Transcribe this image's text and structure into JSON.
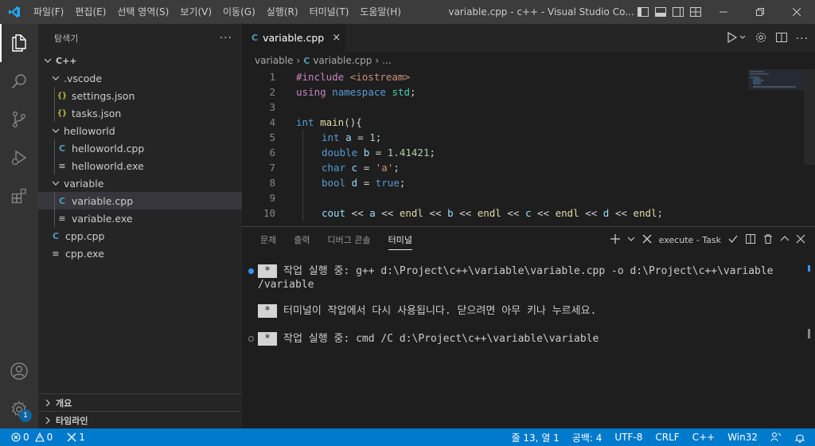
{
  "titlebar": {
    "menus": [
      "파일(F)",
      "편집(E)",
      "선택 영역(S)",
      "보기(V)",
      "이동(G)",
      "실행(R)",
      "터미널(T)",
      "도움말(H)"
    ],
    "window_title": "variable.cpp - c++ - Visual Studio Co..."
  },
  "sidebar": {
    "title": "탐색기",
    "more": "···",
    "root": "C++",
    "tree": [
      {
        "label": ".vscode",
        "kind": "folder",
        "depth": 1
      },
      {
        "label": "settings.json",
        "kind": "json",
        "depth": 2
      },
      {
        "label": "tasks.json",
        "kind": "json",
        "depth": 2
      },
      {
        "label": "helloworld",
        "kind": "folder",
        "depth": 1
      },
      {
        "label": "helloworld.cpp",
        "kind": "cpp",
        "depth": 2
      },
      {
        "label": "helloworld.exe",
        "kind": "exe",
        "depth": 2
      },
      {
        "label": "variable",
        "kind": "folder",
        "depth": 1
      },
      {
        "label": "variable.cpp",
        "kind": "cpp",
        "depth": 2,
        "selected": true
      },
      {
        "label": "variable.exe",
        "kind": "exe",
        "depth": 2
      },
      {
        "label": "cpp.cpp",
        "kind": "cpp",
        "depth": 1
      },
      {
        "label": "cpp.exe",
        "kind": "exe",
        "depth": 1
      }
    ],
    "outline": "개요",
    "timeline": "타임라인"
  },
  "editor": {
    "tab_label": "variable.cpp",
    "tab_close": "×",
    "breadcrumb": {
      "folder": "variable",
      "file": "variable.cpp",
      "ellipsis": "..."
    },
    "line_numbers": [
      "1",
      "2",
      "3",
      "4",
      "5",
      "6",
      "7",
      "8",
      "9",
      "10"
    ]
  },
  "code": {
    "l1": {
      "a": "#include ",
      "b": "<iostream>"
    },
    "l2": {
      "a": "using",
      "b": " ",
      "c": "namespace",
      "d": " ",
      "e": "std",
      "f": ";"
    },
    "l4": {
      "a": "int",
      "b": " ",
      "c": "main",
      "d": "(){"
    },
    "l5": {
      "a": "int",
      "b": " ",
      "c": "a",
      "d": " = ",
      "e": "1",
      "f": ";"
    },
    "l6": {
      "a": "double",
      "b": " ",
      "c": "b",
      "d": " = ",
      "e": "1.41421",
      "f": ";"
    },
    "l7": {
      "a": "char",
      "b": " ",
      "c": "c",
      "d": " = ",
      "e": "'a'",
      "f": ";"
    },
    "l8": {
      "a": "bool",
      "b": " ",
      "c": "d",
      "d": " = ",
      "e": "true",
      "f": ";"
    },
    "l10": {
      "a": "cout",
      "b": " << ",
      "c": "a",
      "d": " << ",
      "e": "endl",
      "f": " << ",
      "g": "b",
      "h": " << ",
      "i": "endl",
      "j": " << ",
      "k": "c",
      "l": " << ",
      "m": "endl",
      "n": " << ",
      "o": "d",
      "p": " << ",
      "q": "endl",
      "r": ";"
    }
  },
  "panel": {
    "tabs": [
      "문제",
      "출력",
      "디버그 콘솔",
      "터미널"
    ],
    "active_tab": "터미널",
    "task_label": "execute - Task",
    "terminal": {
      "star": "*",
      "line1": "작업 실행 중: g++ d:\\Project\\c++\\variable\\variable.cpp -o d:\\Project\\c++\\variable",
      "line1b": "/variable",
      "line2": "터미널이 작업에서 다시 사용됩니다. 닫으려면 아무 키나 누르세요.",
      "line3": "작업 실행 중: cmd /C d:\\Project\\c++\\variable\\variable"
    }
  },
  "statusbar": {
    "errors": "0",
    "warnings": "0",
    "ports": "1",
    "position": "줄 13, 열 1",
    "spaces": "공백: 4",
    "encoding": "UTF-8",
    "eol": "CRLF",
    "language": "C++",
    "platform": "Win32"
  },
  "activitybar": {
    "accounts_badge": "1"
  },
  "colors": {
    "accent": "#007acc",
    "titlebar": "#3c3c3c",
    "sidebar": "#252526",
    "editor": "#1e1e1e"
  }
}
